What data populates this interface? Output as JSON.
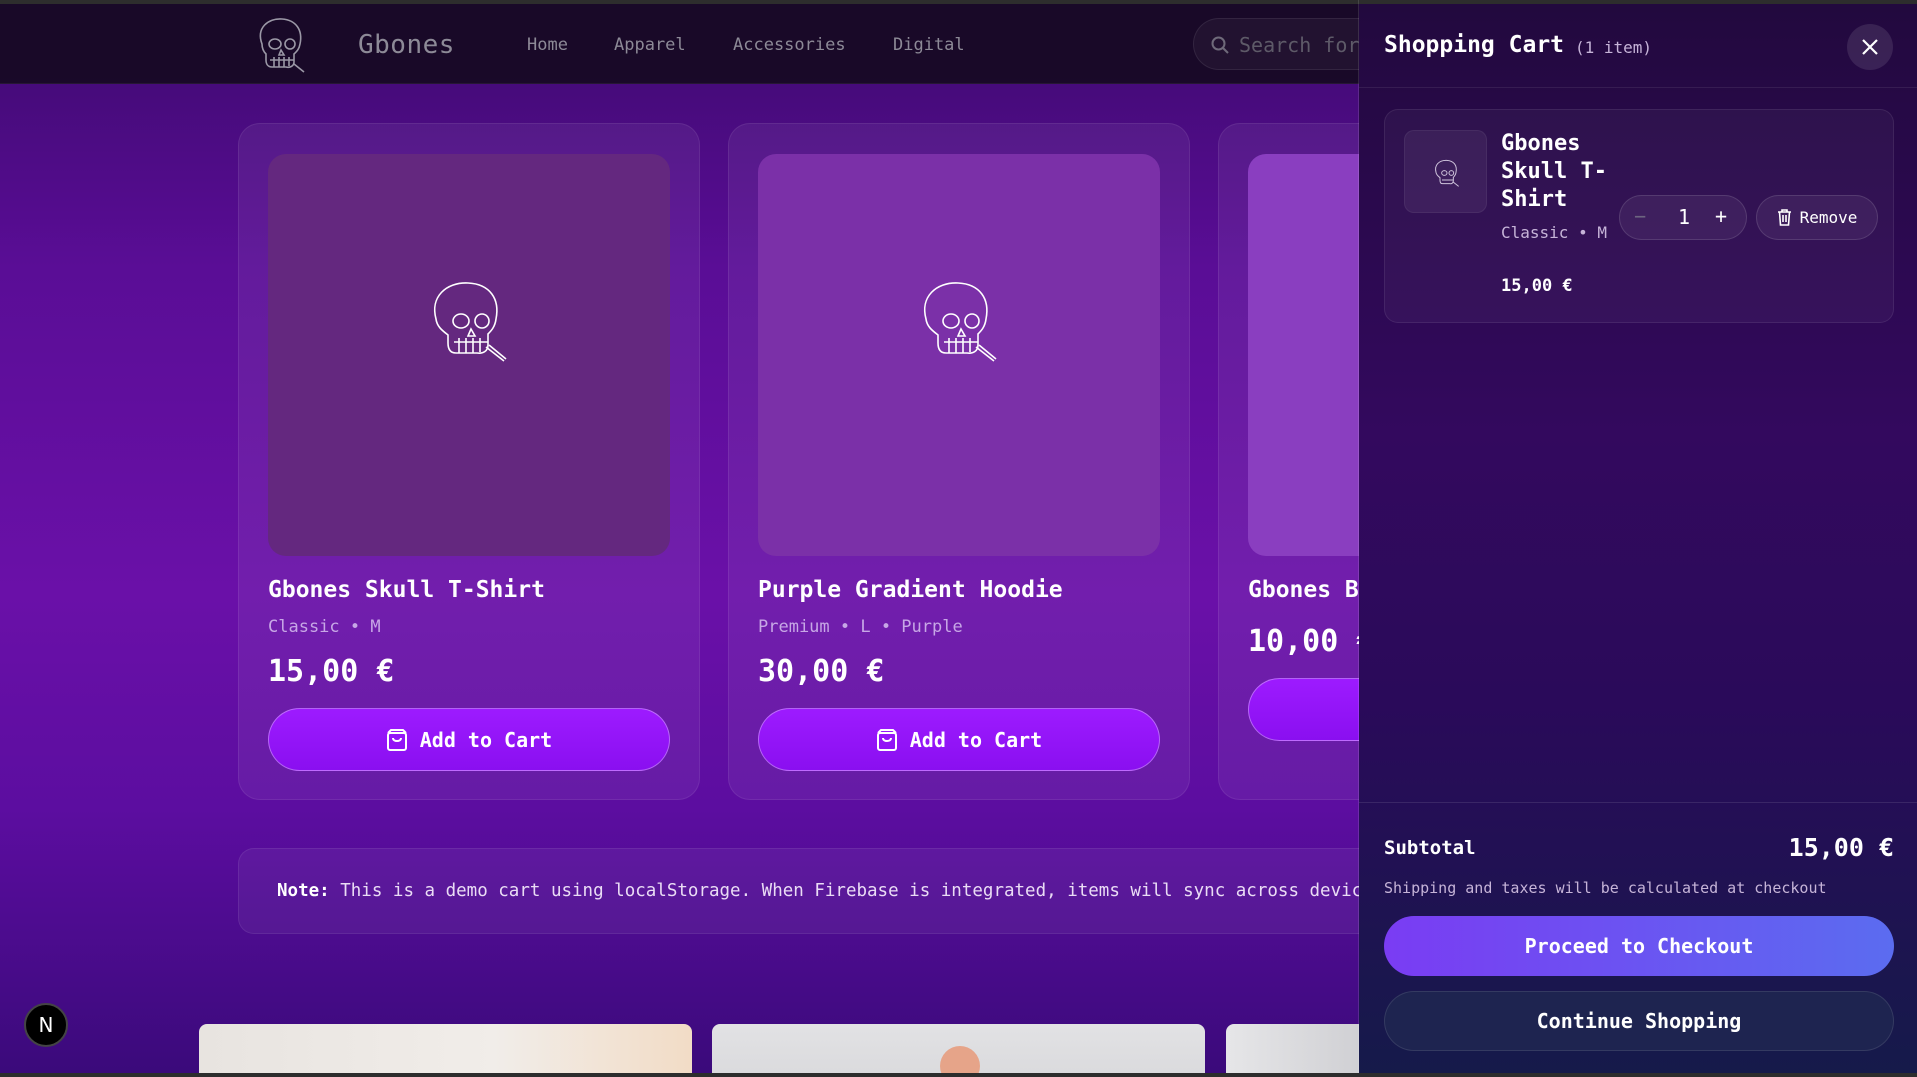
{
  "header": {
    "brand": "Gbones",
    "nav": [
      "Home",
      "Apparel",
      "Accessories",
      "Digital"
    ],
    "search_placeholder": "Search for"
  },
  "products": [
    {
      "title": "Gbones Skull T-Shirt",
      "meta": "Classic • M",
      "price": "15,00 €",
      "button": "Add to Cart",
      "image_icon": "skull-icon"
    },
    {
      "title": "Purple Gradient Hoodie",
      "meta": "Premium • L • Purple",
      "price": "30,00 €",
      "button": "Add to Cart",
      "image_icon": "skull-icon"
    },
    {
      "title": "Gbones B",
      "meta": "",
      "price": "10,00 €",
      "button": ""
    }
  ],
  "note": {
    "label": "Note:",
    "text": " This is a demo cart using localStorage. When Firebase is integrated, items will sync across devic"
  },
  "badge": "N",
  "cart": {
    "title": "Shopping Cart",
    "count": "(1 item)",
    "items": [
      {
        "name": "Gbones Skull T-Shirt",
        "variant": "Classic • M",
        "price": "15,00 €",
        "quantity": "1",
        "minus": "−",
        "plus": "+",
        "remove": "Remove"
      }
    ],
    "subtotal_label": "Subtotal",
    "subtotal_value": "15,00 €",
    "shipping_note": "Shipping and taxes will be calculated at checkout",
    "checkout": "Proceed to Checkout",
    "continue": "Continue Shopping"
  },
  "colors": {
    "accent": "#8a0ff0",
    "checkout_start": "#7a3cf3",
    "checkout_end": "#5b6cf0"
  }
}
